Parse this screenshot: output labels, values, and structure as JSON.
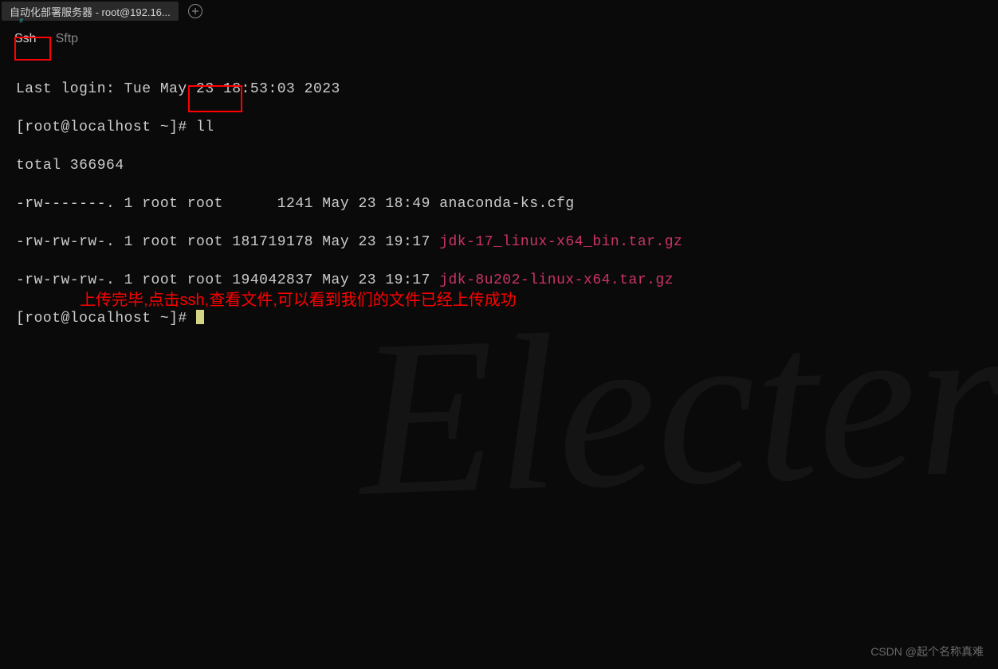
{
  "tab": {
    "title": "自动化部署服务器 - root@192.16..."
  },
  "subtabs": {
    "ssh": "Ssh",
    "sftp": "Sftp"
  },
  "terminal": {
    "last_login": "Last login: Tue May 23 18:53:03 2023",
    "prompt1": "[root@localhost ~]# ",
    "command1": "ll",
    "total": "total 366964",
    "row1_meta": "-rw-------. 1 root root      1241 May 23 18:49 ",
    "row1_file": "anaconda-ks.cfg",
    "row2_meta": "-rw-rw-rw-. 1 root root 181719178 May 23 19:17 ",
    "row2_file": "jdk-17_linux-x64_bin.tar.gz",
    "row3_meta": "-rw-rw-rw-. 1 root root 194042837 May 23 19:17 ",
    "row3_file": "jdk-8u202-linux-x64.tar.gz",
    "prompt2": "[root@localhost ~]# "
  },
  "annotation": "上传完毕,点击ssh,查看文件,可以看到我们的文件已经上传成功",
  "watermark_bg": "Electer",
  "csdn": "CSDN @起个名称真难",
  "tiny": "#"
}
